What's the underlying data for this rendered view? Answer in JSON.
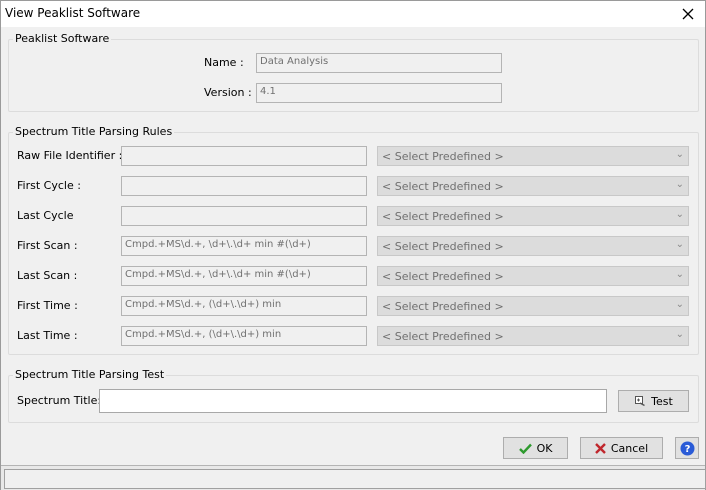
{
  "window": {
    "title": "View Peaklist Software"
  },
  "software": {
    "legend": "Peaklist Software",
    "name_label": "Name :",
    "name_value": "Data Analysis",
    "version_label": "Version :",
    "version_value": "4.1"
  },
  "rules": {
    "legend": "Spectrum Title Parsing Rules",
    "rows": [
      {
        "label": "Raw File Identifier :",
        "value": "",
        "select": "< Select Predefined >"
      },
      {
        "label": "First Cycle :",
        "value": "",
        "select": "< Select Predefined >"
      },
      {
        "label": "Last Cycle",
        "value": "",
        "select": "< Select Predefined >"
      },
      {
        "label": "First Scan :",
        "value": "Cmpd.+MS\\d.+, \\d+\\.\\d+ min #(\\d+)",
        "select": "< Select Predefined >"
      },
      {
        "label": "Last Scan :",
        "value": "Cmpd.+MS\\d.+, \\d+\\.\\d+ min #(\\d+)",
        "select": "< Select Predefined >"
      },
      {
        "label": "First Time :",
        "value": "Cmpd.+MS\\d.+, (\\d+\\.\\d+) min",
        "select": "< Select Predefined >"
      },
      {
        "label": "Last Time :",
        "value": "Cmpd.+MS\\d.+, (\\d+\\.\\d+) min",
        "select": "< Select Predefined >"
      }
    ]
  },
  "test": {
    "legend": "Spectrum Title Parsing Test",
    "title_label": "Spectrum Title:",
    "title_value": "",
    "test_label": "Test"
  },
  "buttons": {
    "ok": "OK",
    "cancel": "Cancel"
  },
  "colors": {
    "ok_check": "#2e9a2e",
    "cancel_x": "#c0272d",
    "help": "#2a5bd7"
  }
}
